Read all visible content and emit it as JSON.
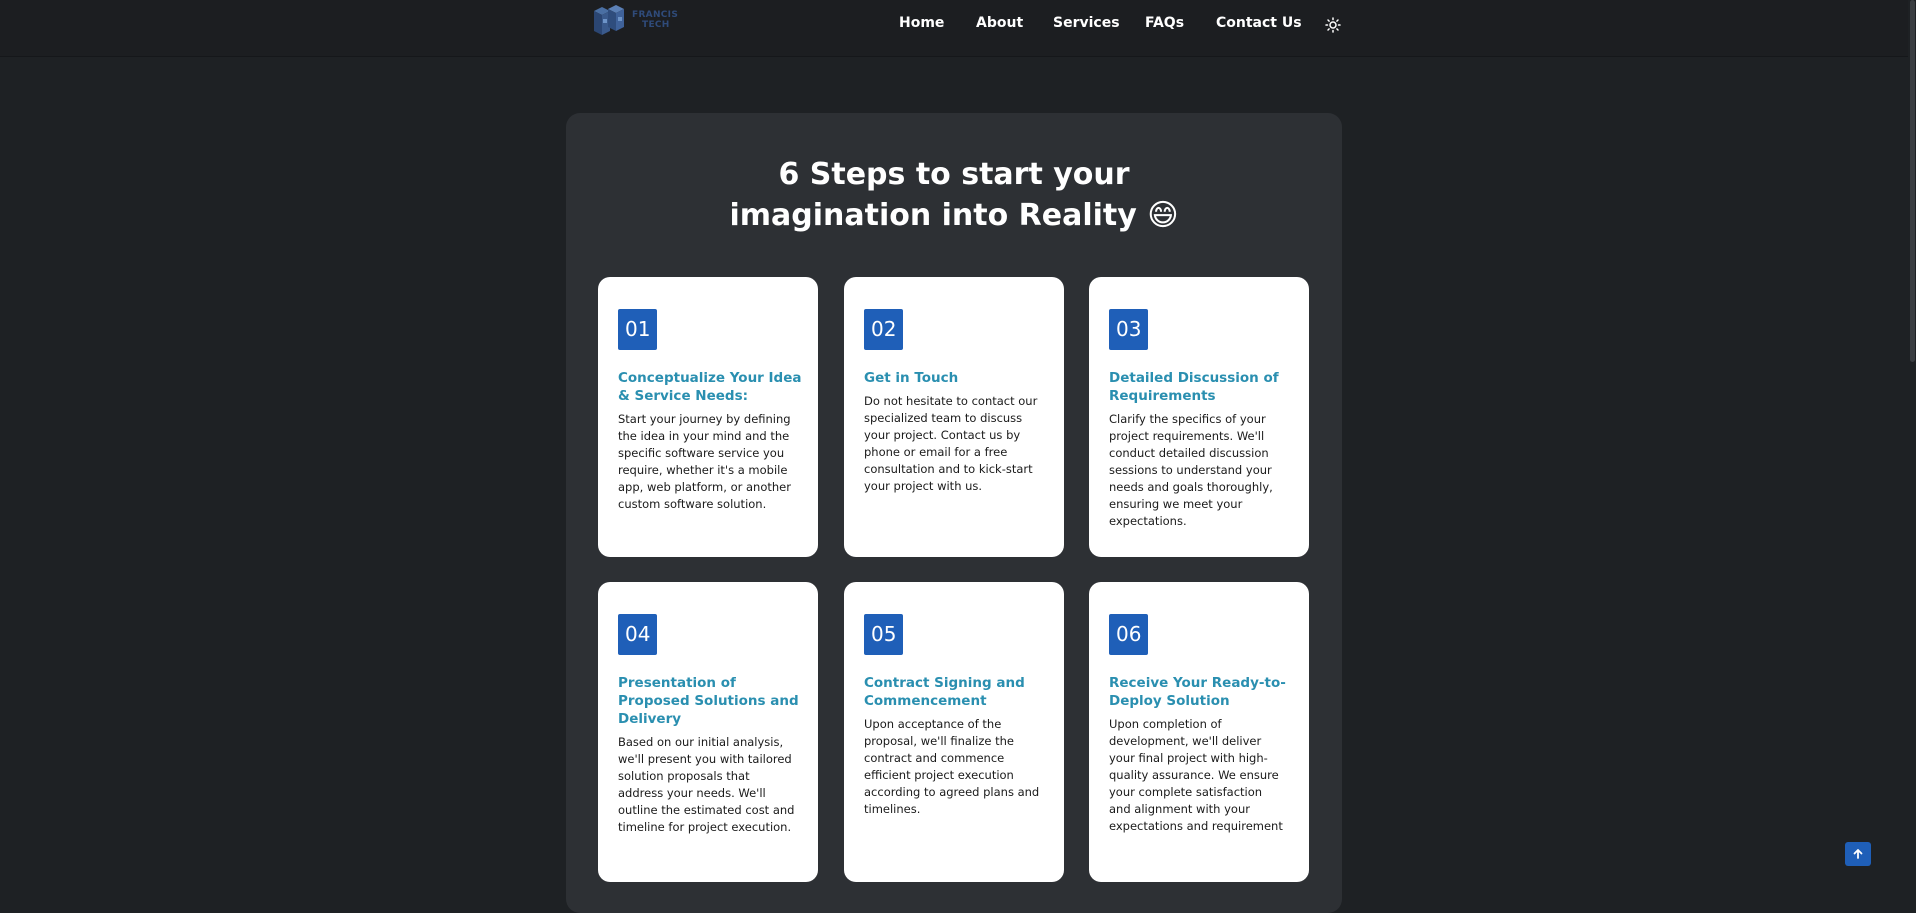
{
  "brand": {
    "name_line1": "FRANCIS",
    "name_line2": "TECH"
  },
  "nav": {
    "items": [
      {
        "label": "Home"
      },
      {
        "label": "About"
      },
      {
        "label": "Services"
      },
      {
        "label": "FAQs"
      },
      {
        "label": "Contact Us"
      }
    ],
    "theme_icon": "sun-icon"
  },
  "section": {
    "title_line1": "6 Steps to start your",
    "title_line2": "imagination into Reality 😄"
  },
  "steps": [
    {
      "number": "01",
      "title": "Conceptualize Your Idea & Service Needs:",
      "body": "Start your journey by defining the idea in your mind and the specific software service you require, whether it's a mobile app, web platform, or another custom software solution."
    },
    {
      "number": "02",
      "title": "Get in Touch",
      "body": "Do not hesitate to contact our specialized team to discuss your project. Contact us by phone or email for a free consultation and to kick-start your project with us."
    },
    {
      "number": "03",
      "title": "Detailed Discussion of Requirements",
      "body": "Clarify the specifics of your project requirements. We'll conduct detailed discussion sessions to understand your needs and goals thoroughly, ensuring we meet your expectations."
    },
    {
      "number": "04",
      "title": "Presentation of Proposed Solutions and Delivery",
      "body": "Based on our initial analysis, we'll present you with tailored solution proposals that address your needs. We'll outline the estimated cost and timeline for project execution."
    },
    {
      "number": "05",
      "title": "Contract Signing and Commencement",
      "body": "Upon acceptance of the proposal, we'll finalize the contract and commence efficient project execution according to agreed plans and timelines."
    },
    {
      "number": "06",
      "title": "Receive Your Ready-to-Deploy Solution",
      "body": "Upon completion of development, we'll deliver your final project with high-quality assurance. We ensure your complete satisfaction and alignment with your expectations and requirement"
    }
  ],
  "scroll_top_icon": "arrow-up-icon"
}
